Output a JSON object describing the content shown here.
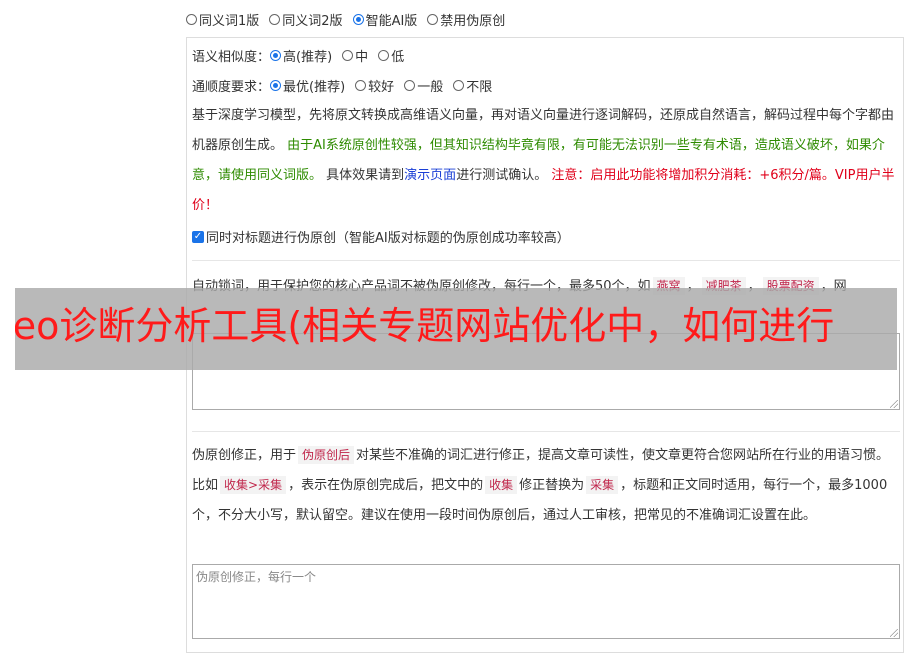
{
  "mode_options": [
    {
      "label": "同义词1版",
      "checked": false
    },
    {
      "label": "同义词2版",
      "checked": false
    },
    {
      "label": "智能AI版",
      "checked": true
    },
    {
      "label": "禁用伪原创",
      "checked": false
    }
  ],
  "similarity": {
    "label": "语义相似度：",
    "options": [
      {
        "label": "高(推荐)",
        "checked": true
      },
      {
        "label": "中",
        "checked": false
      },
      {
        "label": "低",
        "checked": false
      }
    ]
  },
  "fluency": {
    "label": "通顺度要求：",
    "options": [
      {
        "label": "最优(推荐)",
        "checked": true
      },
      {
        "label": "较好",
        "checked": false
      },
      {
        "label": "一般",
        "checked": false
      },
      {
        "label": "不限",
        "checked": false
      }
    ]
  },
  "ai_desc": {
    "part1": "基于深度学习模型，先将原文转换成高维语义向量，再对语义向量进行逐词解码，还原成自然语言，解码过程中每个字都由机器原创生成。",
    "part2": "由于AI系统原创性较强，但其知识结构毕竟有限，有可能无法识别一些专有术语，造成语义破坏，如果介意，请使用同义词版。",
    "part3": "具体效果请到",
    "demo_link": "演示页面",
    "part4": "进行测试确认。",
    "note": "注意：启用此功能将增加积分消耗：+6积分/篇。VIP用户半价！"
  },
  "title_checkbox": {
    "label": "同时对标题进行伪原创（智能AI版对标题的伪原创成功率较高）",
    "checked": true
  },
  "lock": {
    "desc_start": "自动锁词，用于保护您的核心产品词不被伪原创修改，每行一个，最多50个，如",
    "tags": [
      "燕窝",
      "减肥茶",
      "股票配资"
    ],
    "desc_end": "网"
  },
  "correction": {
    "desc1": "伪原创修正，用于",
    "tag1": "伪原创后",
    "desc2": "对某些不准确的词汇进行修正，提高文章可读性，使文章更符合您网站所在行业的用语习惯。比如",
    "tag2": "收集>采集",
    "desc3": "，表示在伪原创完成后，把文中的",
    "tag3": "收集",
    "desc4": "修正替换为",
    "tag4": "采集",
    "desc5": "，标题和正文同时适用，每行一个，最多1000个，不分大小写，默认留空。建议在使用一段时间伪原创后，通过人工审核，把常见的不准确词汇设置在此。",
    "placeholder": "伪原创修正，每行一个"
  },
  "banner_text": "seo诊断分析工具(相关专题网站优化中，如何进行"
}
